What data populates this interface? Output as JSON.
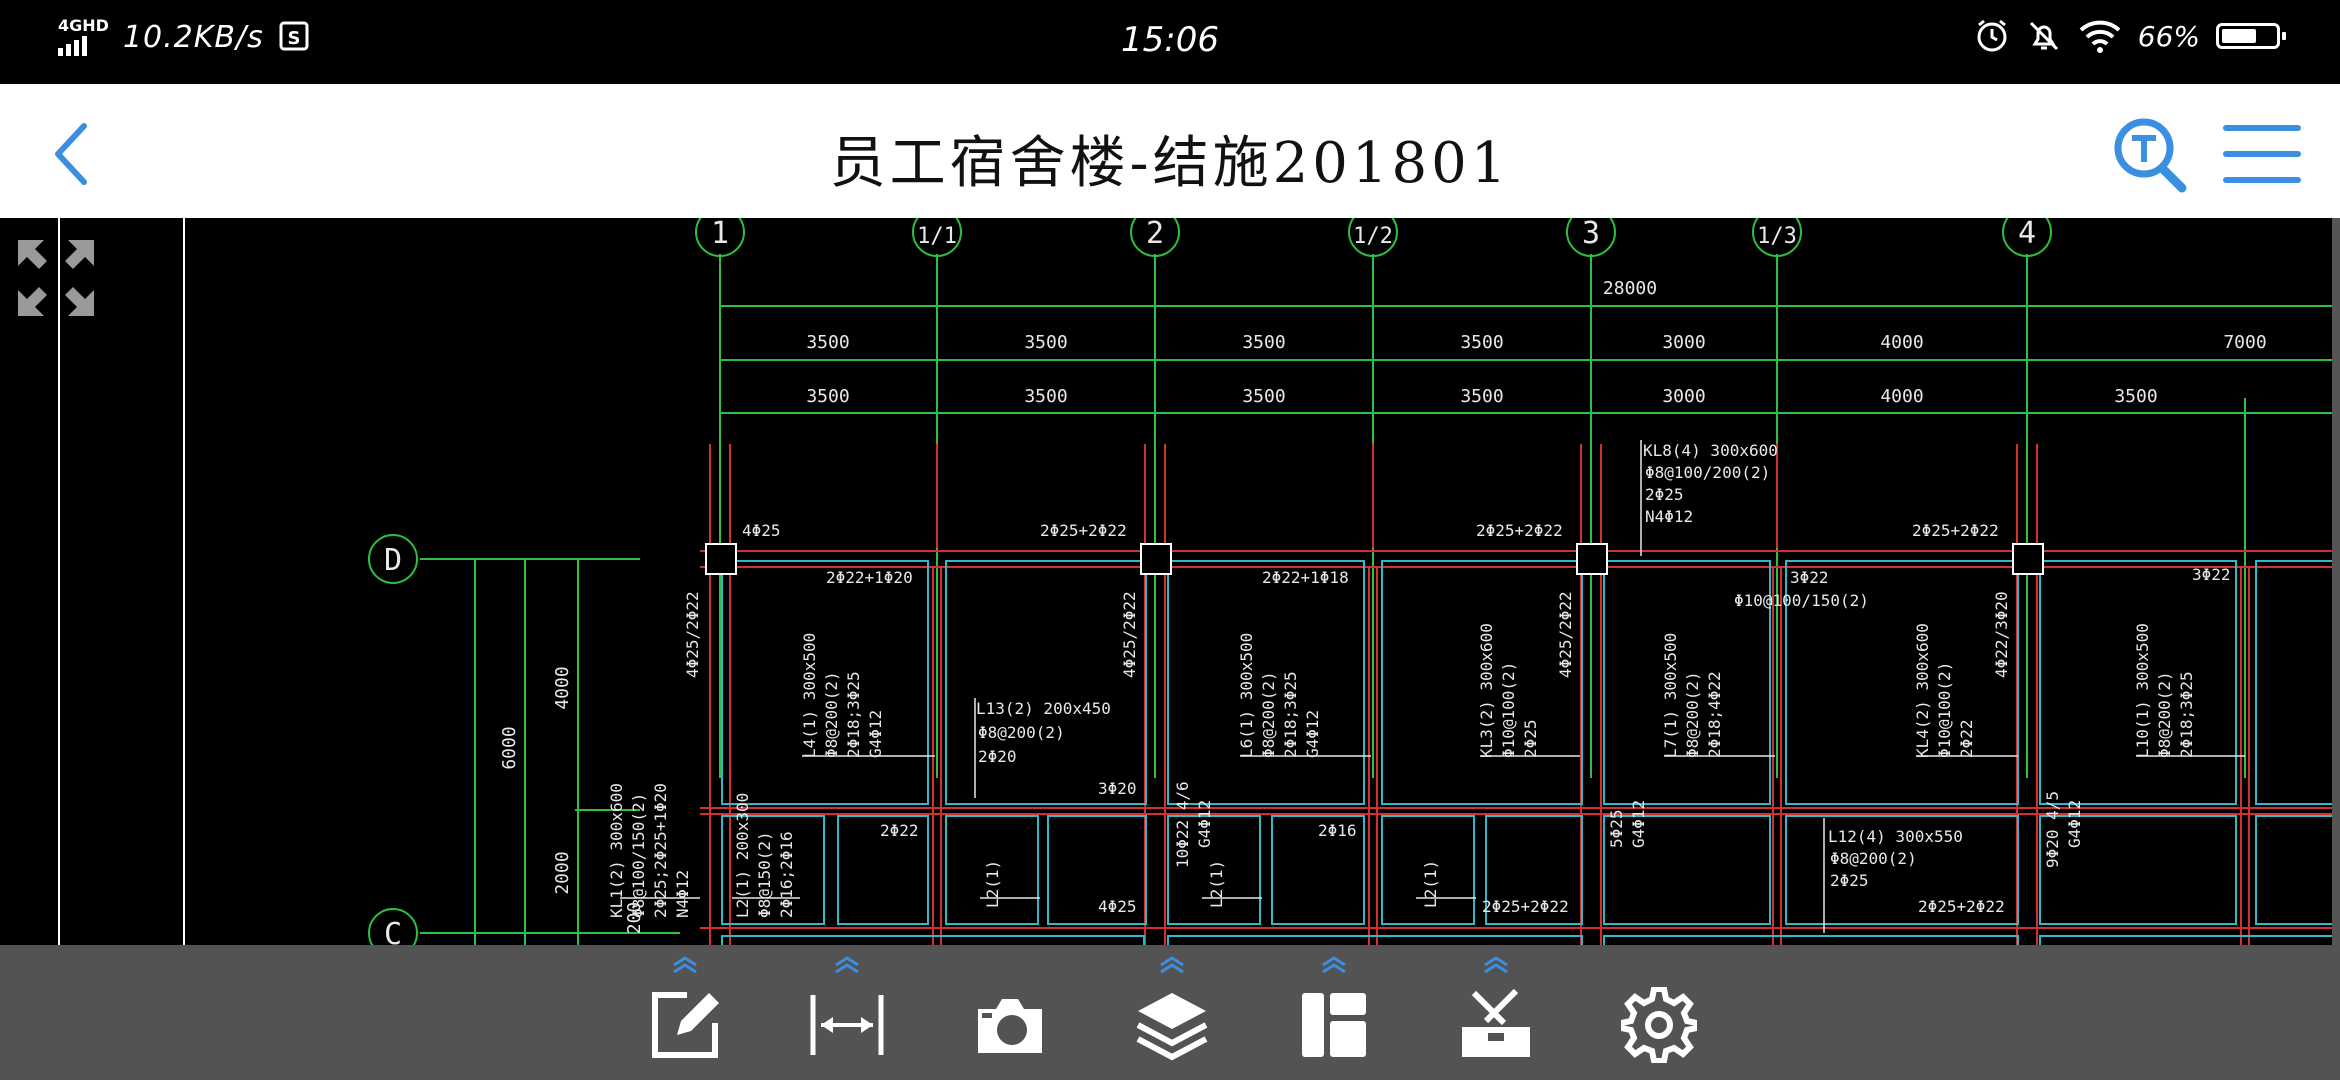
{
  "status_bar": {
    "network": "4GHD",
    "speed": "10.2KB/s",
    "time": "15:06",
    "battery": "66%",
    "battery_level": 0.66
  },
  "header": {
    "title": "员工宿舍楼-结施201801"
  },
  "drawing": {
    "axes_top": [
      "1",
      "1/1",
      "2",
      "1/2",
      "3",
      "1/3",
      "4"
    ],
    "axes_left": [
      "D",
      "C"
    ],
    "total_dim": "28000",
    "dims_row1": [
      "3500",
      "3500",
      "3500",
      "3500",
      "3000",
      "4000",
      "7000"
    ],
    "dims_row2": [
      "3500",
      "3500",
      "3500",
      "3500",
      "3000",
      "4000",
      "3500"
    ],
    "left_dims": [
      "6000",
      "4000",
      "2000",
      "200"
    ],
    "notes": {
      "kl8_1": "KL8(4) 300x600",
      "kl8_2": "Φ8@100/200(2)",
      "kl8_3": "2Φ25",
      "kl8_4": "N4Φ12",
      "beam_top1": "4Φ25",
      "beam_top2": "2Φ25+2Φ22",
      "beam_top3": "2Φ25+2Φ22",
      "beam_top4": "2Φ25+2Φ22",
      "r1": "2Φ22+1Φ20",
      "r2": "2Φ22+1Φ18",
      "r3": "3Φ22",
      "r4": "Φ10@100/150(2)",
      "r5": "3Φ22",
      "l13_1": "L13(2) 200x450",
      "l13_2": "Φ8@200(2)",
      "l13_3": "2Φ20",
      "n_3f20": "3Φ20",
      "n_2f22": "2Φ22",
      "n_2f16": "2Φ16",
      "n_4f25": "4Φ25",
      "n_2f25b": "2Φ25+2Φ22",
      "n_2f25c": "2Φ25+2Φ22",
      "l12_1": "L12(4) 300x550",
      "l12_2": "Φ8@200(2)",
      "l12_3": "2Φ25",
      "v1": "4Φ25/2Φ22",
      "v2": "4Φ25/2Φ22",
      "v3": "4Φ25/2Φ22",
      "v4": "4Φ22/3Φ20",
      "l4": "L4(1) 300x500",
      "l4b": "Φ8@200(2)",
      "l4c": "2Φ18;3Φ25",
      "l4d": "G4Φ12",
      "l6": "L6(1) 300x500",
      "l6b": "Φ8@200(2)",
      "l6c": "2Φ18;3Φ25",
      "l6d": "G4Φ12",
      "kl3": "KL3(2) 300x600",
      "kl3b": "Φ10@100(2)",
      "kl3c": "2Φ25",
      "l7": "L7(1) 300x500",
      "l7b": "Φ8@200(2)",
      "l7c": "2Φ18;4Φ22",
      "kl4": "KL4(2) 300x600",
      "kl4b": "Φ10@100(2)",
      "kl4c": "2Φ22",
      "l10": "L10(1) 300x500",
      "l10b": "Φ8@200(2)",
      "l10c": "2Φ18;3Φ25",
      "kl1": "KL1(2) 300x600",
      "kl1b": "Φ8@100/150(2)",
      "kl1c": "2Φ25;2Φ25+1Φ20",
      "kl1d": "N4Φ12",
      "l2a": "L2(1) 200x300",
      "l2b": "Φ8@150(2)",
      "l2c": "2Φ16;2Φ16",
      "l2s1": "L2(1)",
      "l2s2": "L2(1)",
      "l2s3": "L2(1)",
      "n10": "10Φ22 4/6",
      "n10b": "G4Φ12",
      "n5": "5Φ25",
      "n5b": "G4Φ12",
      "n9": "9Φ20 4/5",
      "n9b": "G4Φ12"
    }
  },
  "toolbar": {
    "tools": [
      "edit-icon",
      "measure-icon",
      "camera-icon",
      "layers-icon",
      "layout-icon",
      "toolbox-icon",
      "settings-icon"
    ],
    "accent": "#3b8fe0"
  }
}
